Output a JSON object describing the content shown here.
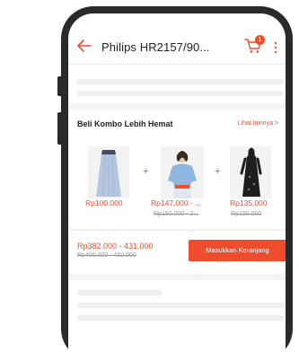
{
  "header": {
    "title": "Philips HR2157/90...",
    "cart_badge": "1",
    "accent": "#ee4d2d"
  },
  "combo": {
    "title": "Beli Kombo Lebih Hemat",
    "see_more": "Lihat lainnya  >",
    "plus": "+",
    "products": [
      {
        "name": "skirt",
        "price": "Rp100.000",
        "old_price": ""
      },
      {
        "name": "blouse",
        "price": "Rp147.000 - ...",
        "old_price": "Rp150.000 - 2..."
      },
      {
        "name": "dress",
        "price": "Rp135.000",
        "old_price": "Rp150.000"
      }
    ],
    "total_price": "Rp382.000 - 431.000",
    "total_old_price": "Rp400.000 - 450.000",
    "add_to_cart_label": "Masukkan Keranjang"
  },
  "icons": {
    "back": "arrow-left-icon",
    "cart": "cart-icon",
    "more": "more-vertical-icon"
  }
}
